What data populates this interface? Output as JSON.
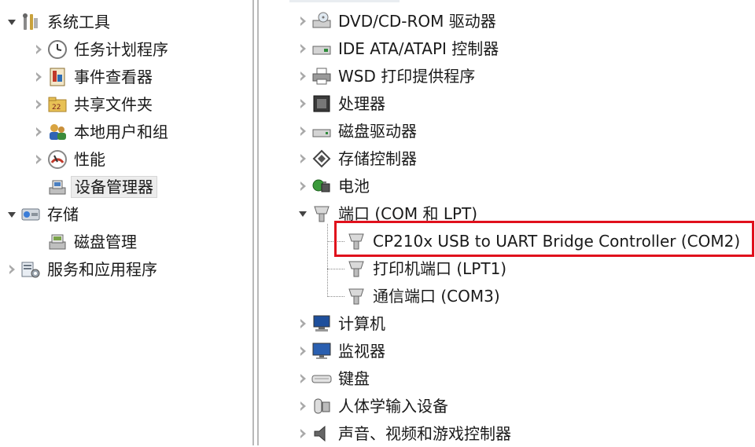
{
  "left_tree": {
    "system_tools": "系统工具",
    "task_scheduler": "任务计划程序",
    "event_viewer": "事件查看器",
    "shared_folders": "共享文件夹",
    "local_users_groups": "本地用户和组",
    "performance": "性能",
    "device_manager": "设备管理器",
    "storage": "存储",
    "disk_management": "磁盘管理",
    "services_apps": "服务和应用程序"
  },
  "device_tree": {
    "dvd": "DVD/CD-ROM 驱动器",
    "ide": "IDE ATA/ATAPI 控制器",
    "wsd": "WSD 打印提供程序",
    "processors": "处理器",
    "disk_drives": "磁盘驱动器",
    "storage_controllers": "存储控制器",
    "battery": "电池",
    "ports": "端口 (COM 和 LPT)",
    "cp210x": "CP210x USB to UART Bridge Controller (COM2)",
    "printer_port": "打印机端口 (LPT1)",
    "comm_port": "通信端口 (COM3)",
    "computer": "计算机",
    "monitors": "监视器",
    "keyboards": "键盘",
    "hid": "人体学输入设备",
    "sound": "声音、视频和游戏控制器"
  },
  "colors": {
    "highlight_border": "#e0101c",
    "selection_bg": "#ececec"
  }
}
